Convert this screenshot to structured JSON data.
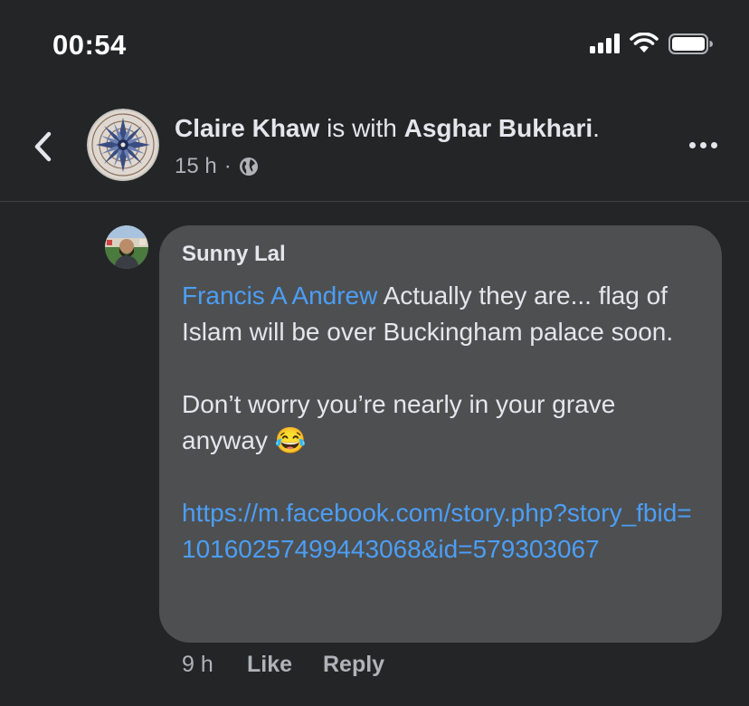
{
  "status_bar": {
    "time": "00:54"
  },
  "post": {
    "author": "Claire Khaw",
    "with_text": "is with",
    "tagged": "Asghar Bukhari",
    "period": ".",
    "time_ago": "15 h",
    "dot": "·",
    "privacy_icon": "globe-icon"
  },
  "comment": {
    "author": "Sunny Lal",
    "mention": "Francis A Andrew",
    "line1_rest": " Actually they are... flag of Islam will be over Buckingham palace soon.",
    "line2": "Don’t worry you’re nearly in your grave anyway ",
    "emoji": "😂",
    "link": "https://m.facebook.com/story.php?story_fbid=10160257499443068&id=579303067",
    "time_ago": "9 h",
    "like_label": "Like",
    "reply_label": "Reply"
  }
}
